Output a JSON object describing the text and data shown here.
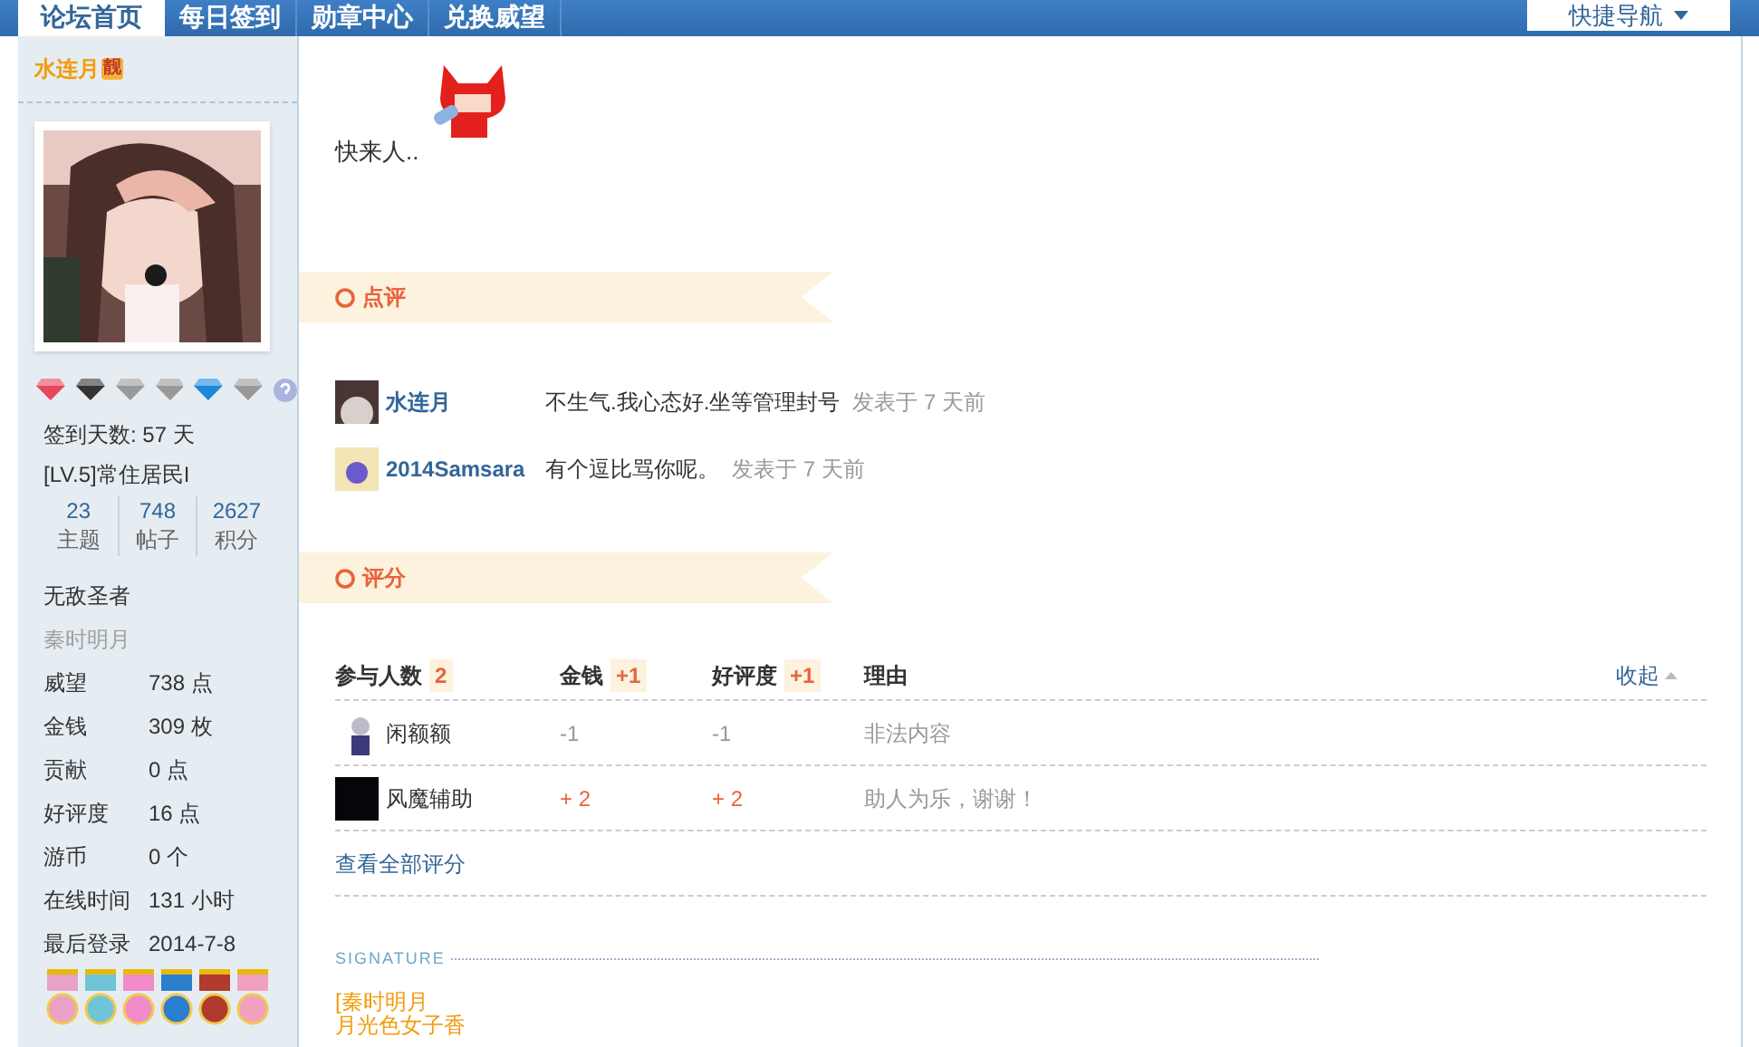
{
  "nav": {
    "tabs": [
      {
        "label": "论坛首页",
        "selected": true
      },
      {
        "label": "每日签到",
        "selected": false
      },
      {
        "label": "勋章中心",
        "selected": false
      },
      {
        "label": "兑换威望",
        "selected": false
      }
    ],
    "quick_nav": "快捷导航"
  },
  "sidebar": {
    "username": "水连月",
    "username_badge": "靓",
    "checkin": "签到天数: 57 天",
    "level": "[LV.5]常住居民I",
    "counts": [
      {
        "value": "23",
        "label": "主题"
      },
      {
        "value": "748",
        "label": "帖子"
      },
      {
        "value": "2627",
        "label": "积分"
      }
    ],
    "titles": [
      {
        "text": "无敌圣者",
        "muted": false
      },
      {
        "text": "秦时明月",
        "muted": true
      }
    ],
    "stats": [
      {
        "label": "威望",
        "value": "738 点"
      },
      {
        "label": "金钱",
        "value": "309 枚"
      },
      {
        "label": "贡献",
        "value": "0 点"
      },
      {
        "label": "好评度",
        "value": "16 点"
      },
      {
        "label": "游币",
        "value": "0 个"
      },
      {
        "label": "在线时间",
        "value": "131 小时"
      },
      {
        "label": "最后登录",
        "value": "2014-7-8"
      }
    ]
  },
  "post": {
    "text": "快来人.."
  },
  "comments": {
    "title": "点评",
    "items": [
      {
        "user": "水连月",
        "text": "不生气.我心态好.坐等管理封号",
        "time": "发表于 7 天前"
      },
      {
        "user": "2014Samsara",
        "text": "有个逗比骂你呢。",
        "time": "发表于 7 天前"
      }
    ]
  },
  "rating": {
    "title": "评分",
    "columns": [
      {
        "label": "参与人数",
        "badge": "2"
      },
      {
        "label": "金钱",
        "badge": "+1"
      },
      {
        "label": "好评度",
        "badge": "+1"
      },
      {
        "label": "理由"
      }
    ],
    "collapse": "收起",
    "rows": [
      {
        "user": "闲额额",
        "money": "-1",
        "rep": "-1",
        "reason": "非法内容",
        "positive": false
      },
      {
        "user": "风魔辅助",
        "money": "+ 2",
        "rep": "+ 2",
        "reason": "助人为乐，谢谢！",
        "positive": true
      }
    ],
    "view_all": "查看全部评分"
  },
  "signature": {
    "label": "SIGNATURE",
    "lines": [
      "[秦时明月",
      "月光色女子香"
    ]
  }
}
